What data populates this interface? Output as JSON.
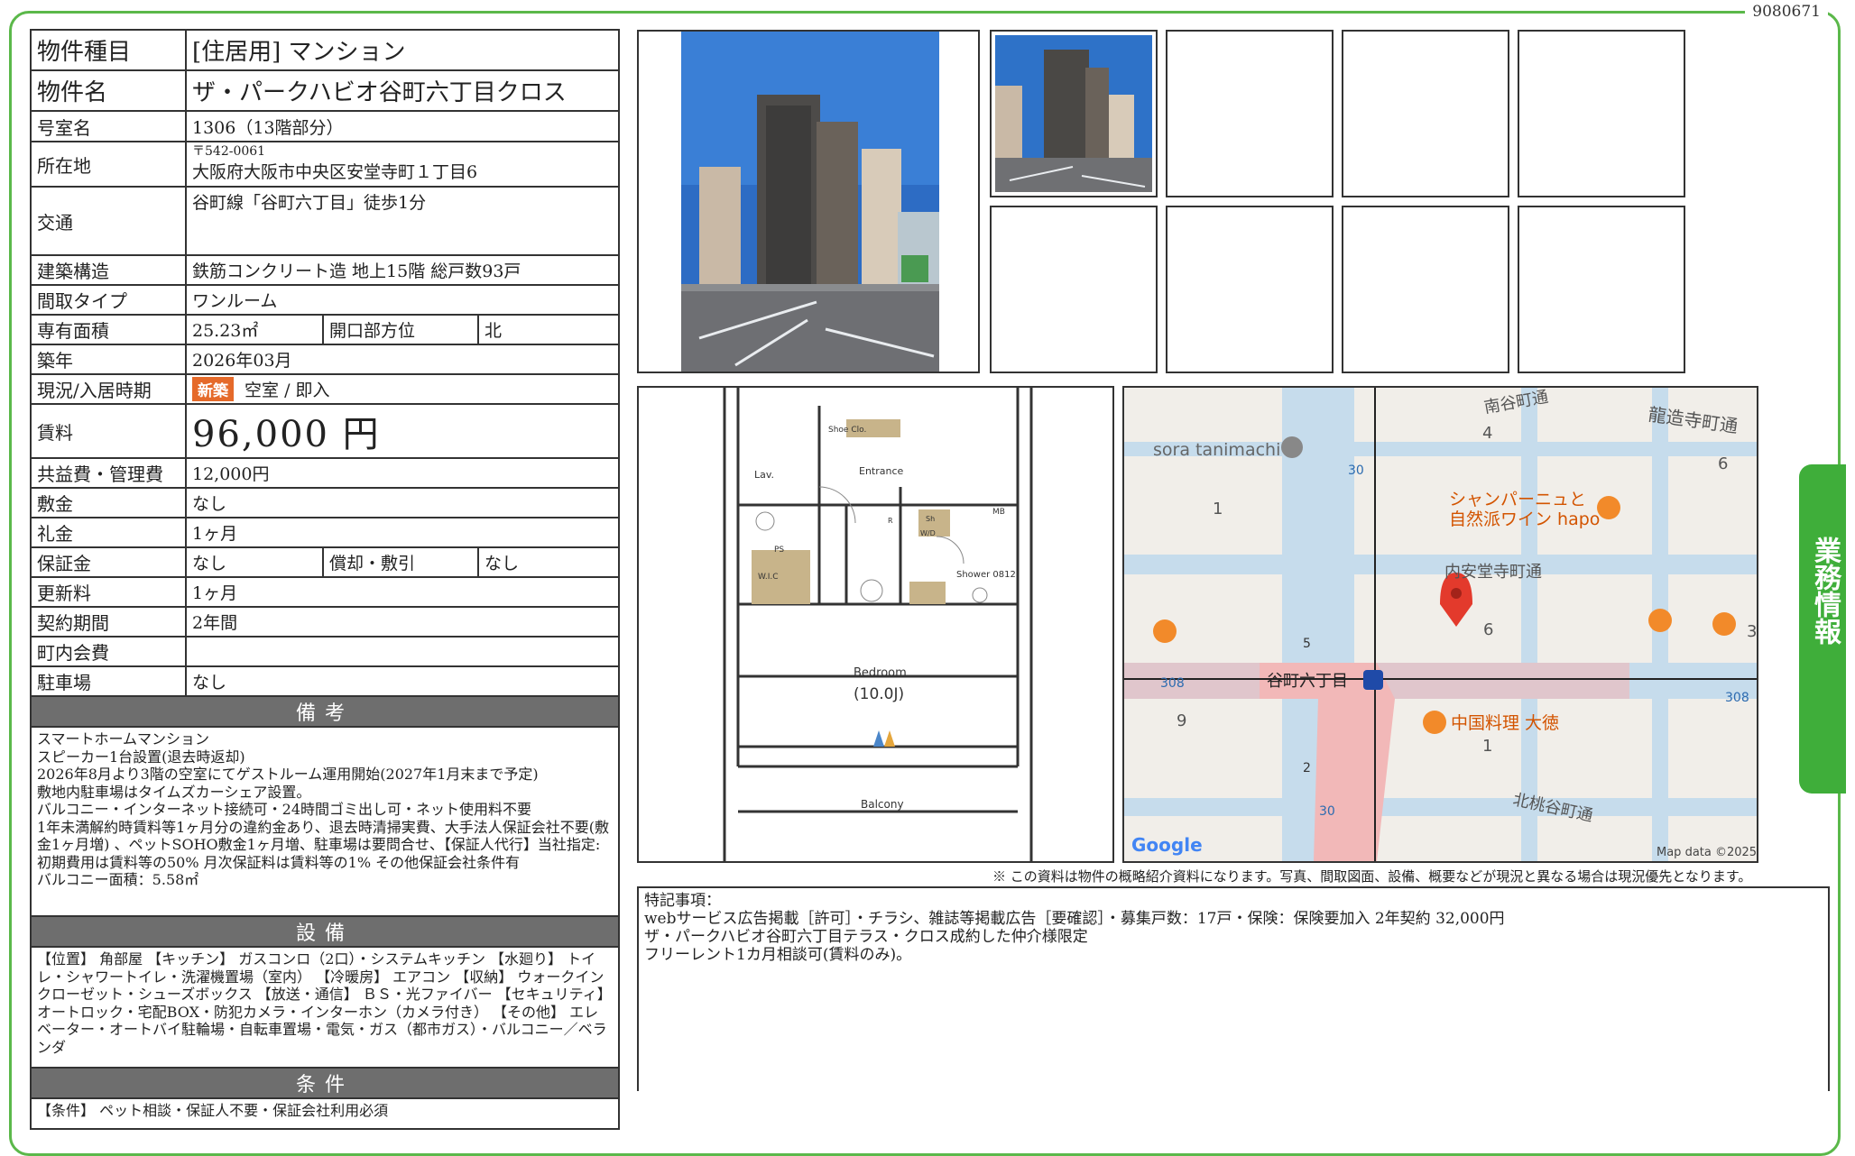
{
  "doc_number": "9080671",
  "side_tab": "業務情報",
  "fields": {
    "type_label": "物件種目",
    "type_value": "[住居用]  マンション",
    "name_label": "物件名",
    "name_value": "ザ・パークハビオ谷町六丁目クロス",
    "room_label": "号室名",
    "room_value": "1306（13階部分）",
    "address_label": "所在地",
    "address_zip": "〒542-0061",
    "address_value": "大阪府大阪市中央区安堂寺町１丁目6",
    "transport_label": "交通",
    "transport_value": "谷町線「谷町六丁目」徒歩1分",
    "structure_label": "建築構造",
    "structure_value": "鉄筋コンクリート造  地上15階  総戸数93戸",
    "layout_label": "間取タイプ",
    "layout_value": "ワンルーム",
    "area_label": "専有面積",
    "area_value": "25.23㎡",
    "facing_label": "開口部方位",
    "facing_value": "北",
    "built_label": "築年",
    "built_value": "2026年03月",
    "status_label": "現況/入居時期",
    "status_badge": "新築",
    "status_value": "空室 / 即入",
    "rent_label": "賃料",
    "rent_value": "96,000 円",
    "fee_label": "共益費・管理費",
    "fee_value": "12,000円",
    "deposit_label": "敷金",
    "deposit_value": "なし",
    "key_money_label": "礼金",
    "key_money_value": "1ヶ月",
    "guarantee_label": "保証金",
    "guarantee_value": "なし",
    "amort_label": "償却・敷引",
    "amort_value": "なし",
    "renewal_label": "更新料",
    "renewal_value": "1ヶ月",
    "contract_label": "契約期間",
    "contract_value": "2年間",
    "community_label": "町内会費",
    "community_value": "",
    "parking_label": "駐車場",
    "parking_value": "なし"
  },
  "remarks": {
    "header": "備考",
    "lines": [
      "スマートホームマンション",
      "スピーカー1台設置(退去時返却)",
      "2026年8月より3階の空室にてゲストルーム運用開始(2027年1月末まで予定)",
      "敷地内駐車場はタイムズカーシェア設置。",
      "バルコニー・インターネット接続可・24時間ゴミ出し可・ネット使用料不要",
      "1年未満解約時賃料等1ヶ月分の違約金あり、退去時清掃実費、大手法人保証会社不要(敷金1ヶ月増)  、ペットSOHO敷金1ヶ月増、駐車場は要問合せ、【保証人代行】当社指定:初期費用は賃料等の50%  月次保証料は賃料等の1%  その他保証会社条件有",
      "バルコニー面積：5.58㎡"
    ]
  },
  "equipment": {
    "header": "設備",
    "text": "【位置】 角部屋 【キッチン】 ガスコンロ（2口）・システムキッチン 【水廻り】 トイレ・シャワートイレ・洗濯機置場（室内） 【冷暖房】 エアコン 【収納】 ウォークインクローゼット・シューズボックス 【放送・通信】 ＢＳ・光ファイバー 【セキュリティ】 オートロック・宅配BOX・防犯カメラ・インターホン（カメラ付き） 【その他】 エレベーター・オートバイ駐輪場・自転車置場・電気・ガス（都市ガス）・バルコニー／ベランダ"
  },
  "conditions": {
    "header": "条件",
    "text": "【条件】 ペット相談・保証人不要・保証会社利用必須"
  },
  "floorplan": {
    "rooms": [
      "Shoe Clo.",
      "Lav.",
      "Entrance",
      "PS",
      "W.I.C",
      "Bedroom",
      "(10.0J)",
      "Shower 0812",
      "MB",
      "Balcony",
      "W/D",
      "R",
      "Sh"
    ]
  },
  "map": {
    "labels": {
      "sora": "sora tanimachi",
      "minami_tanimachi": "南谷町通",
      "ryuzoji": "龍造寺町通",
      "uchiandoji": "内安堂寺町通",
      "kita_uchi": "北桃谷町通",
      "station": "谷町六丁目",
      "restaurant1": "シャンパーニュと",
      "restaurant1b": "自然派ワイン hapo",
      "restaurant2": "中国料理 大徳",
      "n1": "1",
      "n4": "4",
      "n6": "6",
      "n6b": "6",
      "n1b": "1",
      "n9": "9",
      "n3": "3",
      "r30a": "30",
      "r30b": "30",
      "r308a": "308",
      "r308b": "308",
      "r5": "5",
      "r2": "2",
      "google": "Google",
      "mapdata": "Map data ©2025"
    },
    "colors": {
      "road_main": "#c6dcec",
      "crossing": "#f2b8b8",
      "land": "#f1eee9",
      "pin": "#e33a2c"
    }
  },
  "disclaimer": "※ この資料は物件の概略紹介資料になります。写真、間取図面、設備、概要などが現況と異なる場合は現況優先となります。",
  "special_notes": {
    "lines": [
      "特記事項：",
      "webサービス広告掲載［許可］・チラシ、雑誌等掲載広告［要確認］・募集戸数：17戸・保険：保険要加入 2年契約 32,000円",
      "ザ・パークハビオ谷町六丁目テラス・クロス成約した仲介様限定",
      "フリーレント1カ月相談可(賃料のみ)。"
    ]
  }
}
